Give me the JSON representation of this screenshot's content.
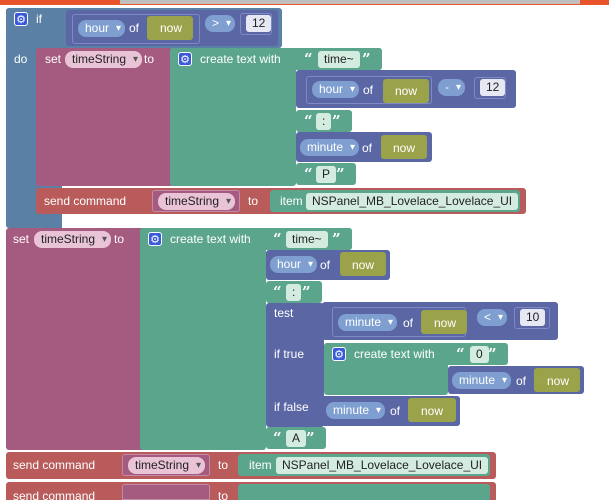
{
  "labels": {
    "if": "if",
    "do": "do",
    "set": "set",
    "to": "to",
    "of": "of",
    "create_text_with": "create text with",
    "send_command": "send command",
    "item": "item",
    "test": "test",
    "if_true": "if true",
    "if_false": "if false"
  },
  "vars": {
    "hour": "hour",
    "minute": "minute",
    "now": "now",
    "timeString": "timeString"
  },
  "ops": {
    "gt": ">",
    "minus": "-",
    "lt": "<"
  },
  "numbers": {
    "twelve": "12",
    "ten": "10"
  },
  "strings": {
    "time_prefix": "time~",
    "colon": ":",
    "p": "P",
    "a": "A",
    "zero": "0"
  },
  "item_name": "NSPanel_MB_Lovelace_Lovelace_UI",
  "icons": {
    "gear": "gear-icon",
    "quote_open": "“",
    "quote_close": "”",
    "dropdown": "chevron-down-icon"
  },
  "colors": {
    "control": "#5b80a5",
    "variable": "#a55b80",
    "text": "#5ba58c",
    "logic": "#5b67a5",
    "command": "#b95b5b"
  }
}
